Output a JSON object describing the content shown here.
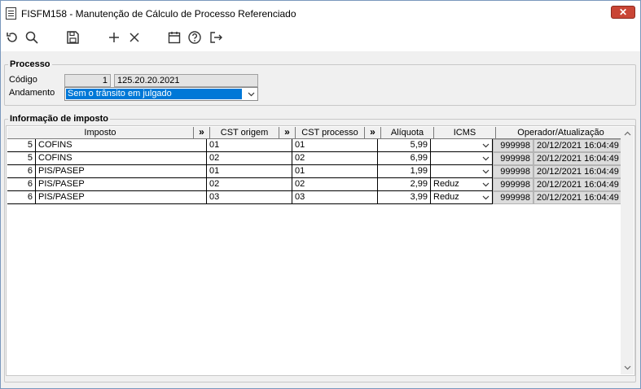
{
  "window": {
    "title": "FISFM158 - Manutenção de Cálculo de Processo Referenciado"
  },
  "toolbar": {
    "items": [
      {
        "name": "refresh-icon"
      },
      {
        "name": "search-icon"
      },
      {
        "name": "save-icon"
      },
      {
        "name": "add-icon"
      },
      {
        "name": "delete-icon"
      },
      {
        "name": "calendar-icon"
      },
      {
        "name": "help-icon"
      },
      {
        "name": "exit-icon"
      }
    ]
  },
  "processo": {
    "legend": "Processo",
    "codigo_label": "Código",
    "codigo_value": "1",
    "numero_value": "125.20.20.2021",
    "andamento_label": "Andamento",
    "andamento_value": "Sem o trânsito em julgado"
  },
  "imposto": {
    "legend": "Informação de imposto",
    "headers": {
      "imposto": "Imposto",
      "expand": "»",
      "cst_origem": "CST origem",
      "cst_processo": "CST processo",
      "aliquota": "Alíquota",
      "icms": "ICMS",
      "operador": "Operador/Atualização"
    },
    "rows": [
      {
        "code": "5",
        "name": "COFINS",
        "cst_origem": "01",
        "cst_processo": "01",
        "aliquota": "5,99",
        "icms": "",
        "operador": "999998",
        "data": "20/12/2021 16:04:49"
      },
      {
        "code": "5",
        "name": "COFINS",
        "cst_origem": "02",
        "cst_processo": "02",
        "aliquota": "6,99",
        "icms": "",
        "operador": "999998",
        "data": "20/12/2021 16:04:49"
      },
      {
        "code": "6",
        "name": "PIS/PASEP",
        "cst_origem": "01",
        "cst_processo": "01",
        "aliquota": "1,99",
        "icms": "",
        "operador": "999998",
        "data": "20/12/2021 16:04:49"
      },
      {
        "code": "6",
        "name": "PIS/PASEP",
        "cst_origem": "02",
        "cst_processo": "02",
        "aliquota": "2,99",
        "icms": "Reduz",
        "operador": "999998",
        "data": "20/12/2021 16:04:49"
      },
      {
        "code": "6",
        "name": "PIS/PASEP",
        "cst_origem": "03",
        "cst_processo": "03",
        "aliquota": "3,99",
        "icms": "Reduz",
        "operador": "999998",
        "data": "20/12/2021 16:04:49"
      }
    ]
  }
}
